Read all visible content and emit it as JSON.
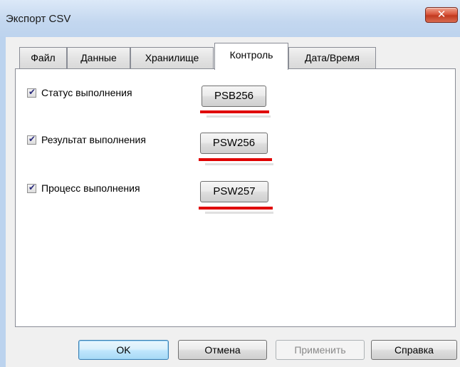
{
  "window": {
    "title": "Экспорт CSV",
    "close_glyph": "✕"
  },
  "tabs": [
    {
      "label": "Файл"
    },
    {
      "label": "Данные"
    },
    {
      "label": "Хранилище"
    },
    {
      "label": "Контроль"
    },
    {
      "label": "Дата/Время"
    }
  ],
  "active_tab": "Контроль",
  "controls": [
    {
      "label": "Статус выполнения",
      "checked": true,
      "address": "PSB256"
    },
    {
      "label": "Результат выполнения",
      "checked": true,
      "address": "PSW256"
    },
    {
      "label": "Процесс выполнения",
      "checked": true,
      "address": "PSW257"
    }
  ],
  "buttons": {
    "ok": "OK",
    "cancel": "Отмена",
    "apply": "Применить",
    "help": "Справка"
  },
  "colors": {
    "highlight_underline": "#e00000",
    "close_button": "#c8452b"
  }
}
